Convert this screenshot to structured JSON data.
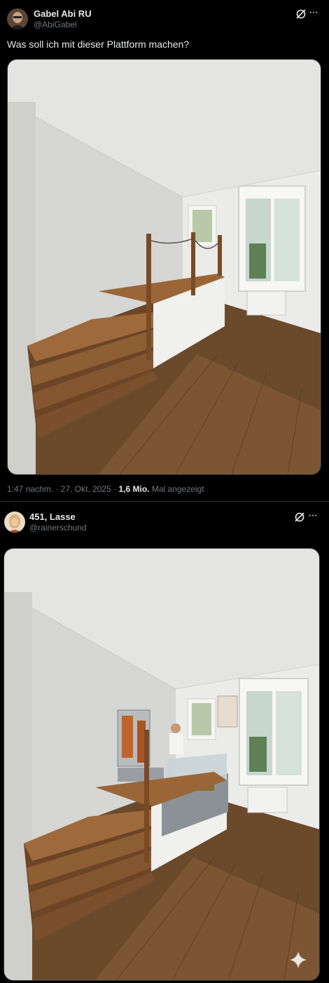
{
  "posts": [
    {
      "author_name": "Gabel Abi RU",
      "author_handle": "@AbiGabel",
      "text": "Was soll ich mit dieser Plattform machen?",
      "time": "1:47 nachm.",
      "sep1": "·",
      "date": "27. Okt. 2025",
      "sep2": "·",
      "views": "1,6 Mio.",
      "views_label": "Mal angezeigt",
      "more": "···"
    },
    {
      "author_name": "451, Lasse",
      "author_handle": "@rainerschund",
      "more": "···"
    }
  ],
  "icons": {
    "grok": "grok-icon",
    "more": "more-icon",
    "sparkle": "sparkle-icon"
  },
  "colors": {
    "background": "#000000",
    "text": "#e7e9ea",
    "secondary": "#71767b",
    "border": "#2f3336"
  }
}
